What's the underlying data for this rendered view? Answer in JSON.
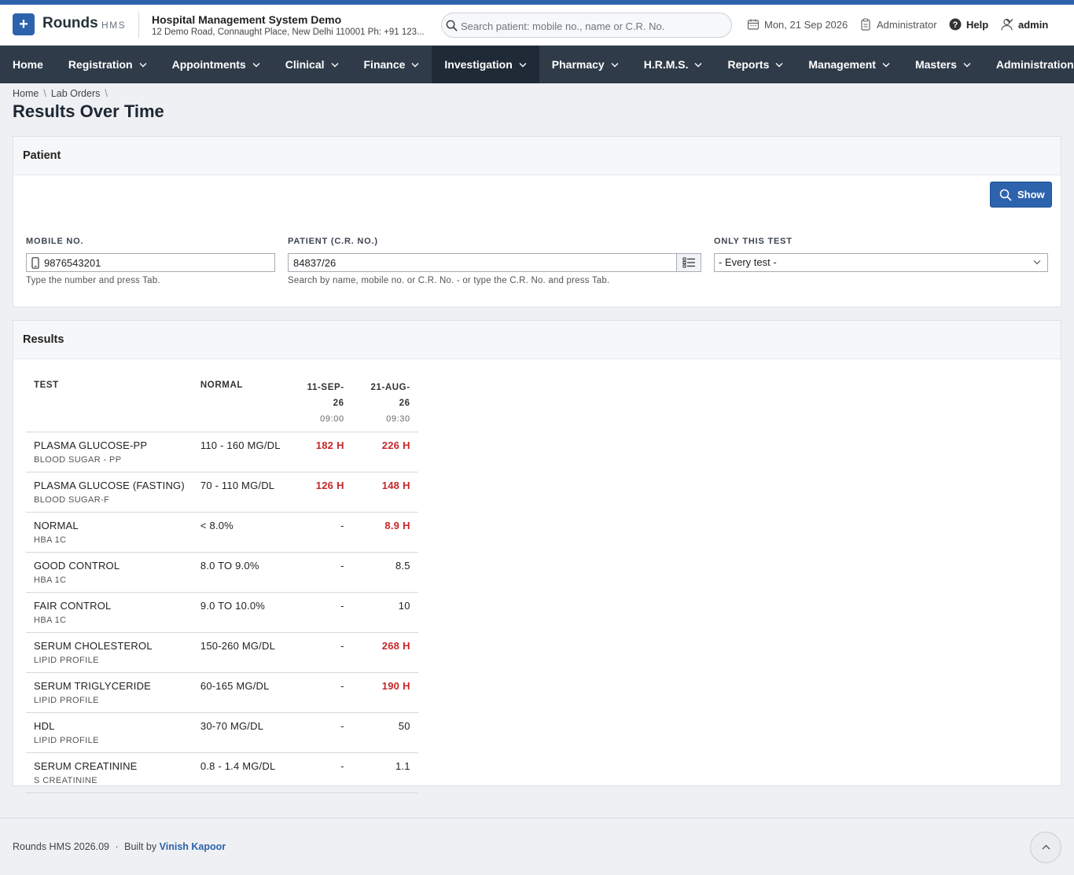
{
  "brand": {
    "name": "Rounds",
    "suffix": "HMS",
    "logo_glyph": "+",
    "accent": "#2d63ad"
  },
  "org": {
    "name": "Hospital Management System Demo",
    "address": "12 Demo Road, Connaught Place, New Delhi 110001 Ph: +91 123..."
  },
  "search": {
    "placeholder": "Search patient: mobile no., name or C.R. No."
  },
  "header": {
    "date": "Mon, 21 Sep 2026",
    "role": "Administrator",
    "help": "Help",
    "user": "admin"
  },
  "nav": [
    {
      "label": "Home",
      "has_menu": false
    },
    {
      "label": "Registration",
      "has_menu": true
    },
    {
      "label": "Appointments",
      "has_menu": true
    },
    {
      "label": "Clinical",
      "has_menu": true
    },
    {
      "label": "Finance",
      "has_menu": true
    },
    {
      "label": "Investigation",
      "has_menu": true,
      "active": true
    },
    {
      "label": "Pharmacy",
      "has_menu": true
    },
    {
      "label": "H.R.M.S.",
      "has_menu": true
    },
    {
      "label": "Reports",
      "has_menu": true
    },
    {
      "label": "Management",
      "has_menu": true
    },
    {
      "label": "Masters",
      "has_menu": true
    },
    {
      "label": "Administration",
      "has_menu": true
    }
  ],
  "breadcrumb": {
    "items": [
      "Home",
      "Lab Orders"
    ],
    "separator": "\\"
  },
  "page_title": "Results Over Time",
  "patient_panel": {
    "title": "Patient",
    "show_button": "Show",
    "mobile": {
      "label": "MOBILE NO.",
      "value": "9876543201",
      "hint": "Type the number and press Tab."
    },
    "patient": {
      "label": "PATIENT (C.R. NO.)",
      "value": "84837/26",
      "hint": "Search by name, mobile no. or C.R. No. - or type the C.R. No. and press Tab."
    },
    "test": {
      "label": "ONLY THIS TEST",
      "selected": "- Every test -"
    }
  },
  "results_panel": {
    "title": "Results",
    "columns": {
      "test": "TEST",
      "normal": "NORMAL",
      "dates": [
        {
          "date": "11-SEP-26",
          "time": "09:00"
        },
        {
          "date": "21-AUG-26",
          "time": "09:30"
        }
      ]
    },
    "high_flag": "H",
    "high_color": "#c62828",
    "rows": [
      {
        "test": "PLASMA GLUCOSE-PP",
        "group": "BLOOD SUGAR - PP",
        "normal": "110 - 160 MG/DL",
        "values": [
          {
            "value": "182",
            "high": true
          },
          {
            "value": "226",
            "high": true
          }
        ]
      },
      {
        "test": "PLASMA GLUCOSE (FASTING)",
        "group": "BLOOD SUGAR-F",
        "normal": "70 - 110 MG/DL",
        "values": [
          {
            "value": "126",
            "high": true
          },
          {
            "value": "148",
            "high": true
          }
        ]
      },
      {
        "test": "NORMAL",
        "group": "HBA 1C",
        "normal": "< 8.0%",
        "values": [
          {
            "value": "-",
            "high": false
          },
          {
            "value": "8.9",
            "high": true
          }
        ]
      },
      {
        "test": "GOOD CONTROL",
        "group": "HBA 1C",
        "normal": "8.0 TO 9.0%",
        "values": [
          {
            "value": "-",
            "high": false
          },
          {
            "value": "8.5",
            "high": false
          }
        ]
      },
      {
        "test": "FAIR CONTROL",
        "group": "HBA 1C",
        "normal": "9.0 TO 10.0%",
        "values": [
          {
            "value": "-",
            "high": false
          },
          {
            "value": "10",
            "high": false
          }
        ]
      },
      {
        "test": "SERUM CHOLESTEROL",
        "group": "LIPID PROFILE",
        "normal": "150-260 MG/DL",
        "values": [
          {
            "value": "-",
            "high": false
          },
          {
            "value": "268",
            "high": true
          }
        ]
      },
      {
        "test": "SERUM TRIGLYCERIDE",
        "group": "LIPID PROFILE",
        "normal": "60-165 MG/DL",
        "values": [
          {
            "value": "-",
            "high": false
          },
          {
            "value": "190",
            "high": true
          }
        ]
      },
      {
        "test": "HDL",
        "group": "LIPID PROFILE",
        "normal": "30-70 MG/DL",
        "values": [
          {
            "value": "-",
            "high": false
          },
          {
            "value": "50",
            "high": false
          }
        ]
      },
      {
        "test": "SERUM CREATININE",
        "group": "S CREATININE",
        "normal": "0.8 - 1.4 MG/DL",
        "values": [
          {
            "value": "-",
            "high": false
          },
          {
            "value": "1.1",
            "high": false
          }
        ]
      }
    ]
  },
  "footer": {
    "product": "Rounds HMS 2026.09",
    "dot": "·",
    "built_by": "Built by",
    "author": "Vinish Kapoor"
  }
}
